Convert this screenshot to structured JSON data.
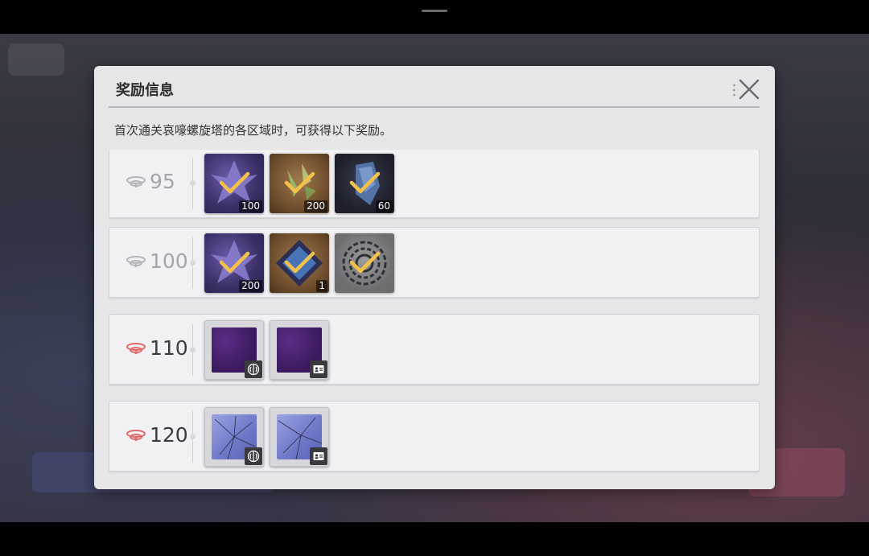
{
  "dialog": {
    "title": "奖励信息",
    "description": "首次通关哀嚎螺旋塔的各区域时，可获得以下奖励。"
  },
  "rows": [
    {
      "level": "95",
      "tier": "grey",
      "items": [
        {
          "icon": "purple-crystal-cluster-icon",
          "quantity": "100",
          "claimed": true
        },
        {
          "icon": "gold-shard-icon",
          "quantity": "200",
          "claimed": true
        },
        {
          "icon": "dark-crystal-icon",
          "quantity": "60",
          "claimed": true
        }
      ]
    },
    {
      "level": "100",
      "tier": "grey",
      "items": [
        {
          "icon": "purple-crystal-cluster-icon",
          "quantity": "200",
          "claimed": true
        },
        {
          "icon": "blue-gem-box-icon",
          "quantity": "1",
          "claimed": true
        },
        {
          "icon": "grey-swirl-icon",
          "quantity": "",
          "claimed": true
        }
      ]
    },
    {
      "level": "110",
      "tier": "red",
      "items": [
        {
          "icon": "violet-avatar-frame-icon",
          "badge": "brain-icon"
        },
        {
          "icon": "violet-name-card-icon",
          "badge": "id-card-icon"
        }
      ]
    },
    {
      "level": "120",
      "tier": "red",
      "items": [
        {
          "icon": "shattered-glass-avatar-frame-icon",
          "badge": "brain-icon"
        },
        {
          "icon": "shattered-glass-name-card-icon",
          "badge": "id-card-icon"
        }
      ]
    }
  ],
  "colors": {
    "check": "#f2c14a",
    "level_red": "#e06a6a",
    "level_grey": "#a5a5a9"
  }
}
